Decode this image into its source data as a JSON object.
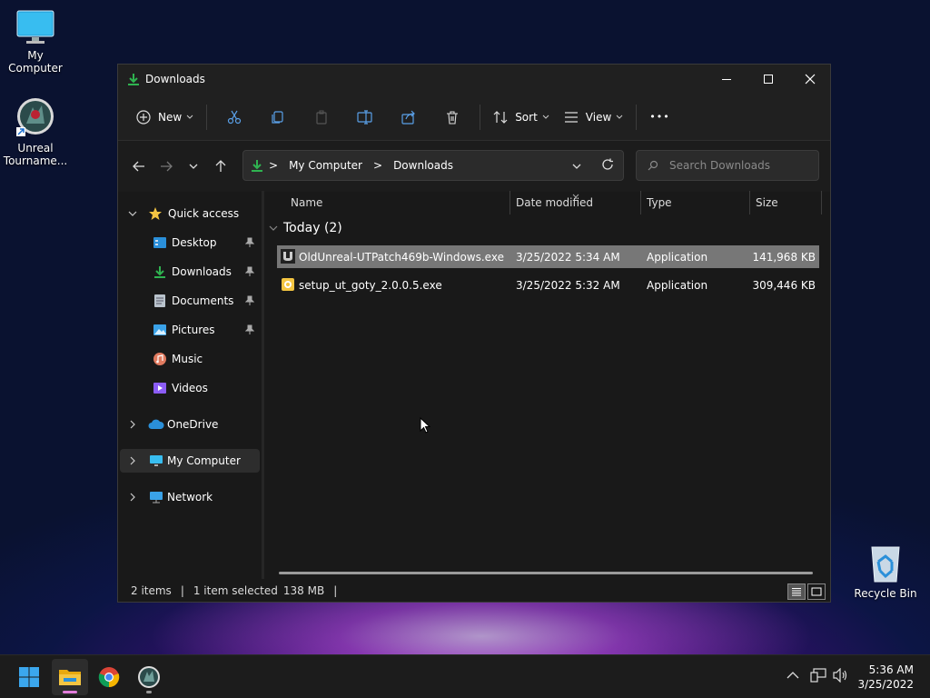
{
  "desktop": {
    "icons": [
      {
        "label": "My Computer"
      },
      {
        "label": "Unreal Tourname..."
      },
      {
        "label": "Recycle Bin"
      }
    ]
  },
  "window": {
    "title": "Downloads",
    "toolbar": {
      "new_label": "New",
      "sort_label": "Sort",
      "view_label": "View",
      "more_label": "•••"
    },
    "address": {
      "crumbs": [
        "My Computer",
        "Downloads"
      ],
      "separator": ">"
    },
    "search": {
      "placeholder": "Search Downloads"
    },
    "nav": {
      "quick_access": "Quick access",
      "items": [
        {
          "label": "Desktop",
          "pinned": true
        },
        {
          "label": "Downloads",
          "pinned": true
        },
        {
          "label": "Documents",
          "pinned": true
        },
        {
          "label": "Pictures",
          "pinned": true
        },
        {
          "label": "Music"
        },
        {
          "label": "Videos"
        }
      ],
      "onedrive": "OneDrive",
      "my_computer": "My Computer",
      "network": "Network"
    },
    "columns": {
      "name": "Name",
      "date": "Date modified",
      "type": "Type",
      "size": "Size"
    },
    "group": {
      "label": "Today (2)"
    },
    "files": [
      {
        "name": "OldUnreal-UTPatch469b-Windows.exe",
        "date": "3/25/2022 5:34 AM",
        "type": "Application",
        "size": "141,968 KB",
        "selected": true
      },
      {
        "name": "setup_ut_goty_2.0.0.5.exe",
        "date": "3/25/2022 5:32 AM",
        "type": "Application",
        "size": "309,446 KB",
        "selected": false
      }
    ],
    "status": {
      "count": "2 items",
      "selection": "1 item selected",
      "size": "138 MB",
      "sep": "|"
    }
  },
  "taskbar": {
    "time": "5:36 AM",
    "date": "3/25/2022"
  },
  "colors": {
    "window_bg": "#191919",
    "selection": "#777777",
    "accent_green": "#2fb350",
    "folder_yellow": "#f4c542"
  }
}
